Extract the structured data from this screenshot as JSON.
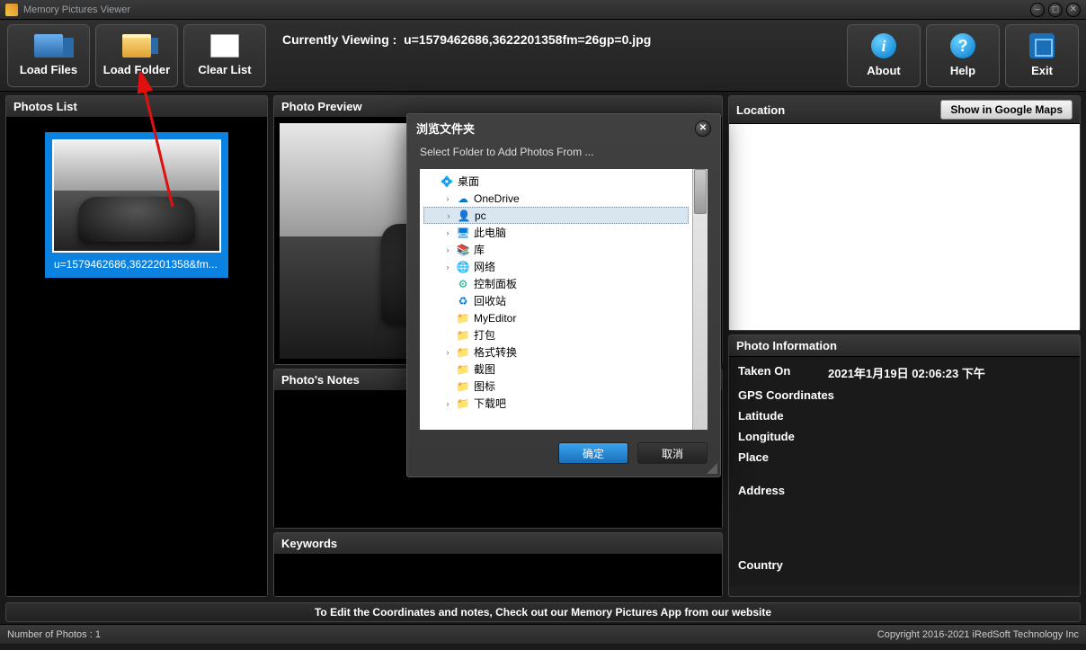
{
  "app": {
    "title": "Memory Pictures Viewer"
  },
  "toolbar": {
    "load_files": "Load Files",
    "load_folder": "Load Folder",
    "clear_list": "Clear List",
    "about": "About",
    "help": "Help",
    "exit": "Exit"
  },
  "currently_viewing_label": "Currently Viewing :",
  "currently_viewing_file": "u=1579462686,3622201358fm=26gp=0.jpg",
  "panels": {
    "photos_list": "Photos List",
    "photo_preview": "Photo Preview",
    "photos_notes": "Photo's Notes",
    "keywords": "Keywords",
    "location": "Location",
    "show_in_maps": "Show in Google Maps",
    "photo_information": "Photo Information"
  },
  "thumb": {
    "filename": "u=1579462686,3622201358&fm..."
  },
  "info": {
    "taken_on_label": "Taken On",
    "taken_on_value": "2021年1月19日 02:06:23 下午",
    "gps_label": "GPS Coordinates",
    "latitude_label": "Latitude",
    "longitude_label": "Longitude",
    "place_label": "Place",
    "address_label": "Address",
    "country_label": "Country"
  },
  "bottom_message": "To Edit the Coordinates and notes, Check out our Memory Pictures App from our website",
  "status": {
    "photos_label": "Number of Photos :",
    "photos_count": "1",
    "copyright": "Copyright 2016-2021 iRedSoft Technology Inc"
  },
  "dialog": {
    "title": "浏览文件夹",
    "subtitle": "Select Folder to Add Photos From ...",
    "ok": "确定",
    "cancel": "取消",
    "tree": [
      {
        "indent": 0,
        "exp": "",
        "icon": "💠",
        "label": "桌面",
        "color": "#1e90ff"
      },
      {
        "indent": 1,
        "exp": "›",
        "icon": "☁",
        "label": "OneDrive",
        "color": "#0078d4"
      },
      {
        "indent": 1,
        "exp": "›",
        "icon": "👤",
        "label": "pc",
        "sel": true,
        "color": "#2e8b57"
      },
      {
        "indent": 1,
        "exp": "›",
        "icon": "🖥",
        "label": "此电脑",
        "color": "#0078d4"
      },
      {
        "indent": 1,
        "exp": "›",
        "icon": "📚",
        "label": "库",
        "color": "#e0a030"
      },
      {
        "indent": 1,
        "exp": "›",
        "icon": "🌐",
        "label": "网络",
        "color": "#0078d4"
      },
      {
        "indent": 1,
        "exp": "",
        "icon": "⚙",
        "label": "控制面板",
        "color": "#2a8"
      },
      {
        "indent": 1,
        "exp": "",
        "icon": "♻",
        "label": "回收站",
        "color": "#0078d4"
      },
      {
        "indent": 1,
        "exp": "",
        "icon": "📁",
        "label": "MyEditor",
        "color": "#e0a030"
      },
      {
        "indent": 1,
        "exp": "",
        "icon": "📁",
        "label": "打包",
        "color": "#e0a030"
      },
      {
        "indent": 1,
        "exp": "›",
        "icon": "📁",
        "label": "格式转换",
        "color": "#e0a030"
      },
      {
        "indent": 1,
        "exp": "",
        "icon": "📁",
        "label": "截图",
        "color": "#e0a030"
      },
      {
        "indent": 1,
        "exp": "",
        "icon": "📁",
        "label": "图标",
        "color": "#e0a030"
      },
      {
        "indent": 1,
        "exp": "›",
        "icon": "📁",
        "label": "下载吧",
        "color": "#e0a030"
      }
    ]
  }
}
